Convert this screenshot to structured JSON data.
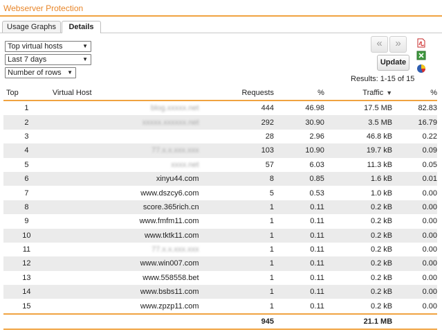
{
  "window_title": "Webserver Protection",
  "tabs": [
    {
      "label": "Usage Graphs",
      "active": false
    },
    {
      "label": "Details",
      "active": true
    }
  ],
  "filters": {
    "report_type": "Top virtual hosts",
    "period": "Last 7 days",
    "rows": "Number of rows"
  },
  "toolbar": {
    "prev_label": "«",
    "next_label": "»",
    "update_label": "Update",
    "export_icons": [
      "pdf-export-icon",
      "excel-export-icon",
      "chart-icon"
    ],
    "results_text": "Results: 1-15 of 15"
  },
  "table": {
    "headers": {
      "top": "Top",
      "host": "Virtual Host",
      "requests": "Requests",
      "req_pct": "%",
      "traffic": "Traffic",
      "traffic_pct": "%"
    },
    "sort_icon": "sort-desc-icon",
    "rows": [
      {
        "top": "1",
        "host": "blog.xxxxx.net",
        "host_blurred": true,
        "requests": "444",
        "req_pct": "46.98",
        "traffic": "17.5 MB",
        "traffic_pct": "82.83"
      },
      {
        "top": "2",
        "host": "xxxxx.xxxxxx.net",
        "host_blurred": true,
        "requests": "292",
        "req_pct": "30.90",
        "traffic": "3.5 MB",
        "traffic_pct": "16.79"
      },
      {
        "top": "3",
        "host": "",
        "host_blurred": false,
        "requests": "28",
        "req_pct": "2.96",
        "traffic": "46.8 kB",
        "traffic_pct": "0.22"
      },
      {
        "top": "4",
        "host": "77.x.x.xxx.xxx",
        "host_blurred": true,
        "requests": "103",
        "req_pct": "10.90",
        "traffic": "19.7 kB",
        "traffic_pct": "0.09"
      },
      {
        "top": "5",
        "host": "xxxx.net",
        "host_blurred": true,
        "requests": "57",
        "req_pct": "6.03",
        "traffic": "11.3 kB",
        "traffic_pct": "0.05"
      },
      {
        "top": "6",
        "host": "xinyu44.com",
        "host_blurred": false,
        "requests": "8",
        "req_pct": "0.85",
        "traffic": "1.6 kB",
        "traffic_pct": "0.01"
      },
      {
        "top": "7",
        "host": "www.dszcy6.com",
        "host_blurred": false,
        "requests": "5",
        "req_pct": "0.53",
        "traffic": "1.0 kB",
        "traffic_pct": "0.00"
      },
      {
        "top": "8",
        "host": "score.365rich.cn",
        "host_blurred": false,
        "requests": "1",
        "req_pct": "0.11",
        "traffic": "0.2 kB",
        "traffic_pct": "0.00"
      },
      {
        "top": "9",
        "host": "www.fmfm11.com",
        "host_blurred": false,
        "requests": "1",
        "req_pct": "0.11",
        "traffic": "0.2 kB",
        "traffic_pct": "0.00"
      },
      {
        "top": "10",
        "host": "www.tktk11.com",
        "host_blurred": false,
        "requests": "1",
        "req_pct": "0.11",
        "traffic": "0.2 kB",
        "traffic_pct": "0.00"
      },
      {
        "top": "11",
        "host": "77.x.x.xxx.xxx",
        "host_blurred": true,
        "requests": "1",
        "req_pct": "0.11",
        "traffic": "0.2 kB",
        "traffic_pct": "0.00"
      },
      {
        "top": "12",
        "host": "www.win007.com",
        "host_blurred": false,
        "requests": "1",
        "req_pct": "0.11",
        "traffic": "0.2 kB",
        "traffic_pct": "0.00"
      },
      {
        "top": "13",
        "host": "www.558558.bet",
        "host_blurred": false,
        "requests": "1",
        "req_pct": "0.11",
        "traffic": "0.2 kB",
        "traffic_pct": "0.00"
      },
      {
        "top": "14",
        "host": "www.bsbs11.com",
        "host_blurred": false,
        "requests": "1",
        "req_pct": "0.11",
        "traffic": "0.2 kB",
        "traffic_pct": "0.00"
      },
      {
        "top": "15",
        "host": "www.zpzp11.com",
        "host_blurred": false,
        "requests": "1",
        "req_pct": "0.11",
        "traffic": "0.2 kB",
        "traffic_pct": "0.00"
      }
    ],
    "totals": {
      "requests": "945",
      "traffic": "21.1 MB"
    }
  },
  "colors": {
    "accent": "#f0a340",
    "title": "#e8862a",
    "row_alt": "#ebebeb"
  }
}
